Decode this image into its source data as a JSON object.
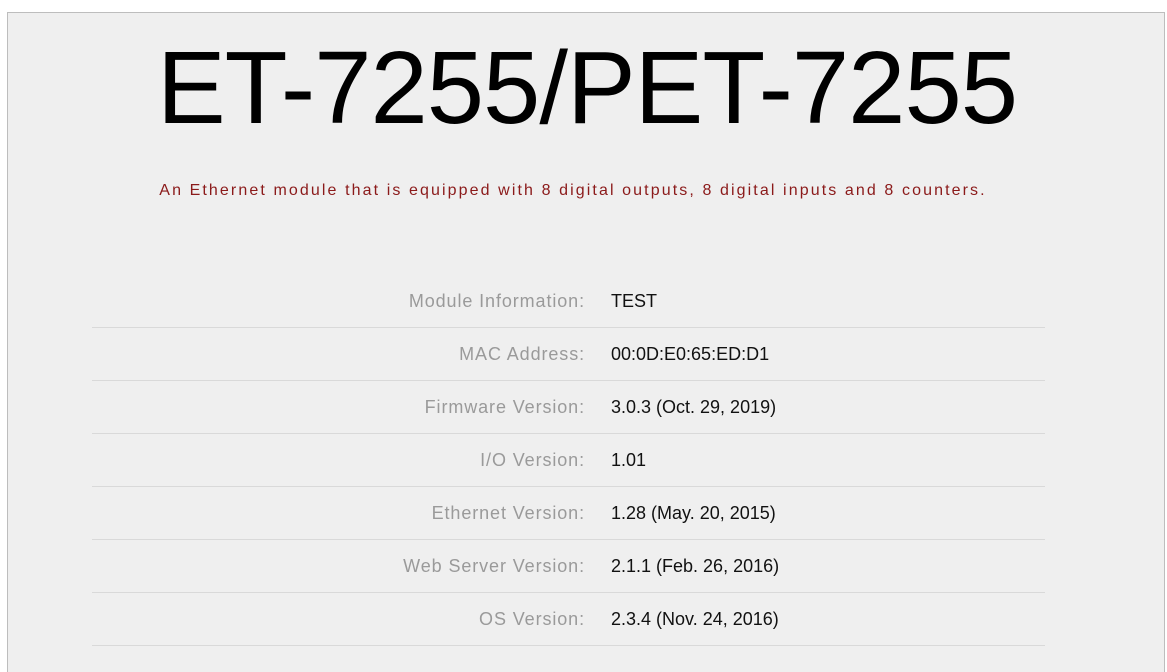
{
  "header": {
    "title": "ET-7255/PET-7255",
    "subtitle": "An Ethernet module that is equipped with 8 digital outputs, 8 digital inputs and 8 counters."
  },
  "info": {
    "rows": [
      {
        "label": "Module Information:",
        "value": "TEST"
      },
      {
        "label": "MAC Address:",
        "value": "00:0D:E0:65:ED:D1"
      },
      {
        "label": "Firmware Version:",
        "value": "3.0.3 (Oct. 29, 2019)"
      },
      {
        "label": "I/O Version:",
        "value": "1.01"
      },
      {
        "label": "Ethernet Version:",
        "value": "1.28 (May. 20, 2015)"
      },
      {
        "label": "Web Server Version:",
        "value": "2.1.1 (Feb. 26, 2016)"
      },
      {
        "label": "OS Version:",
        "value": "2.3.4 (Nov. 24, 2016)"
      }
    ]
  }
}
